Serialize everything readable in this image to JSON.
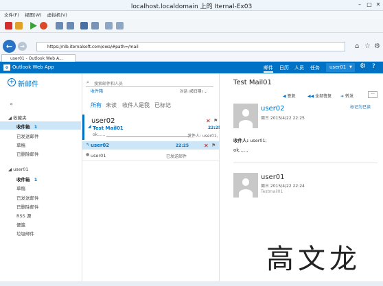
{
  "window": {
    "title": "localhost.localdomain 上的 Iternal-Ex03"
  },
  "menubar": {
    "file": "文件(F)",
    "view": "视图(W)",
    "vm": "虚拟机(V)"
  },
  "browser": {
    "address": "https://nlb.iternalsoft.com/owa/#path=/mail",
    "tab_label": "user01 - Outlook Web A..."
  },
  "owa": {
    "brand": "Outlook Web App",
    "nav": {
      "mail": "邮件",
      "calendar": "日历",
      "people": "人员",
      "tasks": "任务"
    },
    "user": "user01",
    "help": "?"
  },
  "left": {
    "new_mail": "新邮件",
    "collapse": "«",
    "favorites_header": "收藏夹",
    "favorites": [
      {
        "label": "收件箱",
        "count": "1"
      },
      {
        "label": "已发送邮件"
      },
      {
        "label": "草稿"
      },
      {
        "label": "已删除邮件"
      }
    ],
    "account_header": "user01",
    "folders": [
      {
        "label": "收件箱",
        "count": "1"
      },
      {
        "label": "草稿"
      },
      {
        "label": "已发送邮件"
      },
      {
        "label": "已删除邮件"
      },
      {
        "label": "RSS 源"
      },
      {
        "label": "便笺"
      },
      {
        "label": "垃圾邮件"
      }
    ]
  },
  "middle": {
    "search_placeholder": "搜索邮件和人员",
    "folder_name": "收件箱",
    "sort": "对话 (按日期)",
    "filters": {
      "all": "所有",
      "unread": "未读",
      "to_me": "收件人是我",
      "flagged": "已标记"
    },
    "messages": [
      {
        "sender": "user02",
        "subject": "Test Mail01",
        "time": "22:25",
        "preview": "ok......",
        "preview_right": "发件人: user01,"
      },
      {
        "sender": "user02",
        "time": "22:25"
      },
      {
        "sender": "user01",
        "right": "已发送邮件"
      }
    ]
  },
  "reading": {
    "subject": "Test Mail01",
    "actions": {
      "reply": "答复",
      "reply_all": "全部答复",
      "forward": "转发",
      "more": "···"
    },
    "mark_read": "标记为已读",
    "msg1": {
      "sender": "user02",
      "date": "周三 2015/4/22 22:25",
      "to_label": "收件人:",
      "to": "user01;",
      "body": "ok......"
    },
    "msg2": {
      "sender": "user01",
      "date": "周三 2015/4/22 22:24",
      "preview": "Testmail01"
    }
  },
  "watermark": "高文龙",
  "colors": {
    "brand": "#0072c6",
    "selected": "#cde6f7",
    "flag_red": "#cc0000"
  }
}
